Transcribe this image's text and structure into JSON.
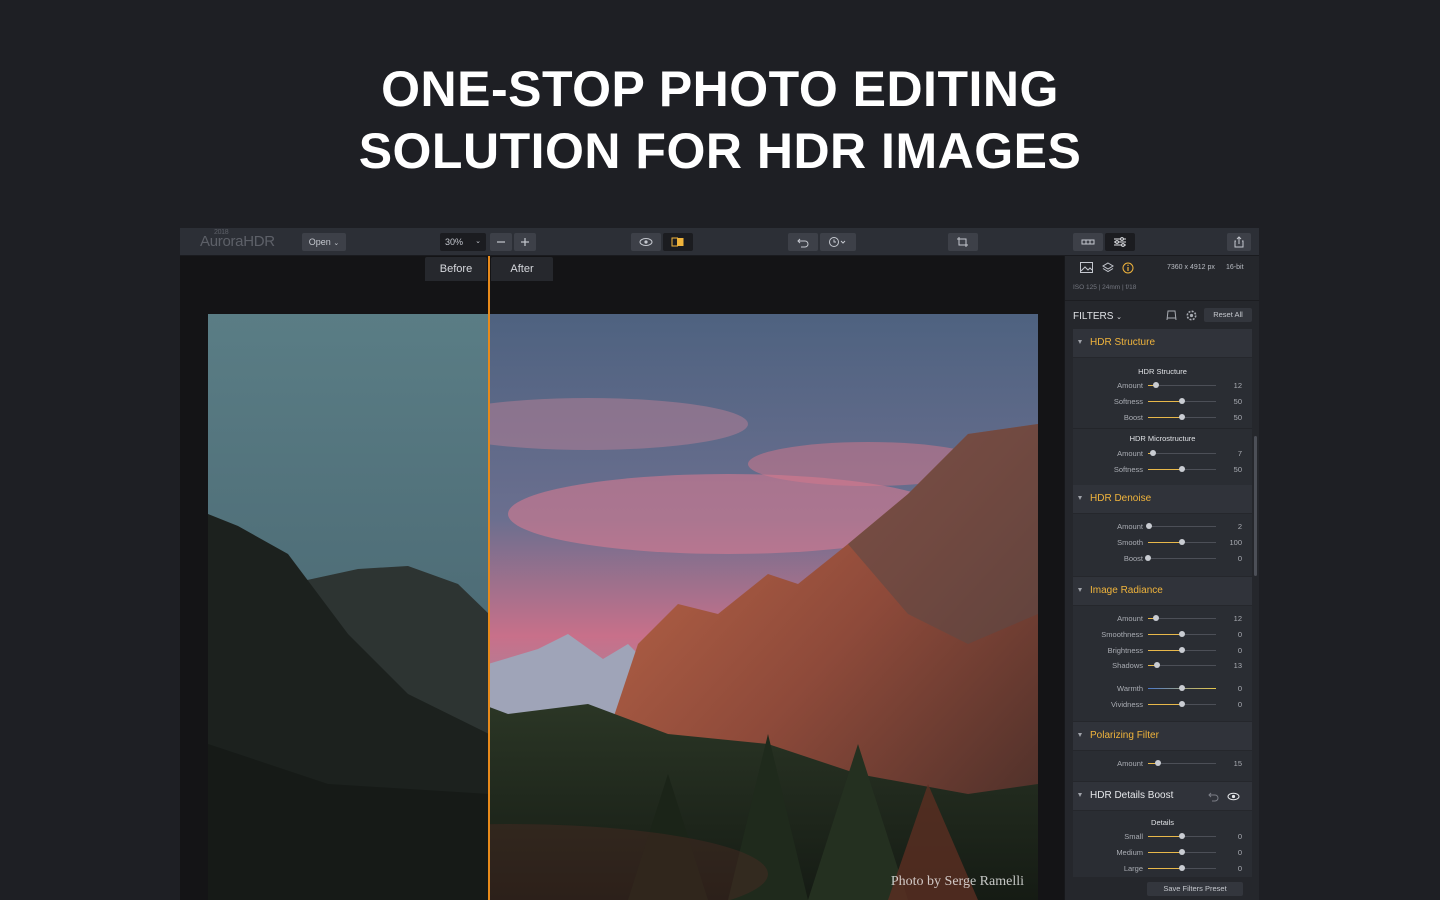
{
  "headline": {
    "line1": "ONE-STOP PHOTO EDITING",
    "line2": "SOLUTION FOR HDR IMAGES"
  },
  "toolbar": {
    "logo": "AuroraHDR",
    "logo_year": "2018",
    "open_label": "Open",
    "zoom_value": "30%",
    "icons": [
      "zoom-out-icon",
      "zoom-in-icon",
      "eye-icon",
      "compare-icon",
      "undo-icon",
      "history-icon",
      "crop-icon",
      "filmstrip-icon",
      "adjustments-icon",
      "share-icon"
    ]
  },
  "canvas": {
    "before_label": "Before",
    "after_label": "After",
    "credit": "Photo by Serge Ramelli"
  },
  "panel": {
    "resolution": "7360 x 4912 px",
    "bit_depth": "16-bit",
    "meta": "ISO 125  |  24mm  |  f/18",
    "filters_label": "FILTERS",
    "reset_label": "Reset All",
    "save_label": "Save Filters Preset",
    "sections": [
      {
        "title": "HDR Structure",
        "groups": [
          {
            "subtitle": "HDR Structure",
            "sliders": [
              {
                "label": "Amount",
                "value": "12",
                "pos": 0.12
              },
              {
                "label": "Softness",
                "value": "50",
                "pos": 0.5
              },
              {
                "label": "Boost",
                "value": "50",
                "pos": 0.5
              }
            ]
          },
          {
            "subtitle": "HDR Microstructure",
            "sliders": [
              {
                "label": "Amount",
                "value": "7",
                "pos": 0.07
              },
              {
                "label": "Softness",
                "value": "50",
                "pos": 0.5
              }
            ]
          }
        ]
      },
      {
        "title": "HDR Denoise",
        "sliders": [
          {
            "label": "Amount",
            "value": "2",
            "pos": 0.02
          },
          {
            "label": "Smooth",
            "value": "100",
            "pos": 0.5
          },
          {
            "label": "Boost",
            "value": "0",
            "pos": 0.0
          }
        ]
      },
      {
        "title": "Image Radiance",
        "sliders": [
          {
            "label": "Amount",
            "value": "12",
            "pos": 0.12
          },
          {
            "label": "Smoothness",
            "value": "0",
            "pos": 0.5
          },
          {
            "label": "Brightness",
            "value": "0",
            "pos": 0.5
          },
          {
            "label": "Shadows",
            "value": "13",
            "pos": 0.13
          },
          {
            "label": "Warmth",
            "value": "0",
            "pos": 0.5
          },
          {
            "label": "Vividness",
            "value": "0",
            "pos": 0.5
          }
        ]
      },
      {
        "title": "Polarizing Filter",
        "sliders": [
          {
            "label": "Amount",
            "value": "15",
            "pos": 0.15
          }
        ]
      },
      {
        "title": "HDR Details Boost",
        "subtitle": "Details",
        "sliders": [
          {
            "label": "Small",
            "value": "0",
            "pos": 0.5
          },
          {
            "label": "Medium",
            "value": "0",
            "pos": 0.5
          },
          {
            "label": "Large",
            "value": "0",
            "pos": 0.5
          }
        ]
      }
    ]
  },
  "colors": {
    "accent": "#f0b43c",
    "divider": "#e88a1a",
    "background": "#1e1f24"
  }
}
